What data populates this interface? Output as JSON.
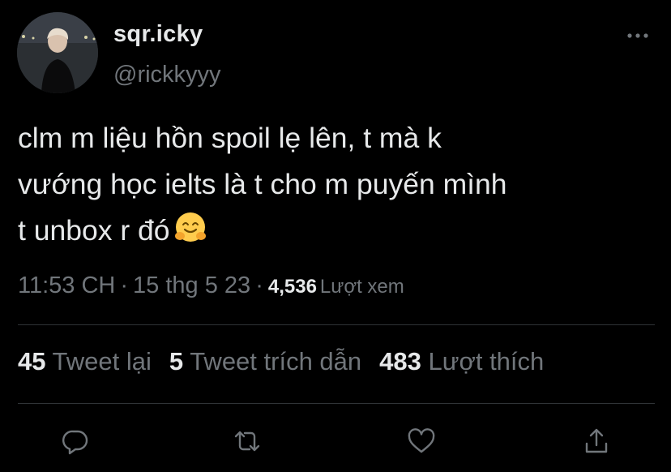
{
  "user": {
    "display_name": "sqr.icky",
    "handle": "@rickkyyy",
    "avatar_icon": "profile-photo"
  },
  "tweet": {
    "lines": [
      "clm m liệu hồn spoil lẹ lên, t mà k",
      "vướng học ielts là t cho m puyến mình",
      "t unbox r đó"
    ],
    "emoji": "hugging-face-emoji"
  },
  "meta": {
    "time": "11:53 CH",
    "separator": "·",
    "date": "15 thg 5 23",
    "views_count": "4,536",
    "views_label": "Lượt xem"
  },
  "stats": {
    "retweets_count": "45",
    "retweets_label": "Tweet lại",
    "quotes_count": "5",
    "quotes_label": "Tweet trích dẫn",
    "likes_count": "483",
    "likes_label": "Lượt thích"
  },
  "actions": [
    {
      "name": "reply",
      "icon": "reply-icon"
    },
    {
      "name": "retweet",
      "icon": "retweet-icon"
    },
    {
      "name": "like",
      "icon": "heart-icon"
    },
    {
      "name": "share",
      "icon": "share-icon"
    }
  ],
  "colors": {
    "background": "#000000",
    "text_primary": "#e7e9ea",
    "text_secondary": "#71767b",
    "divider": "#2f3336"
  }
}
